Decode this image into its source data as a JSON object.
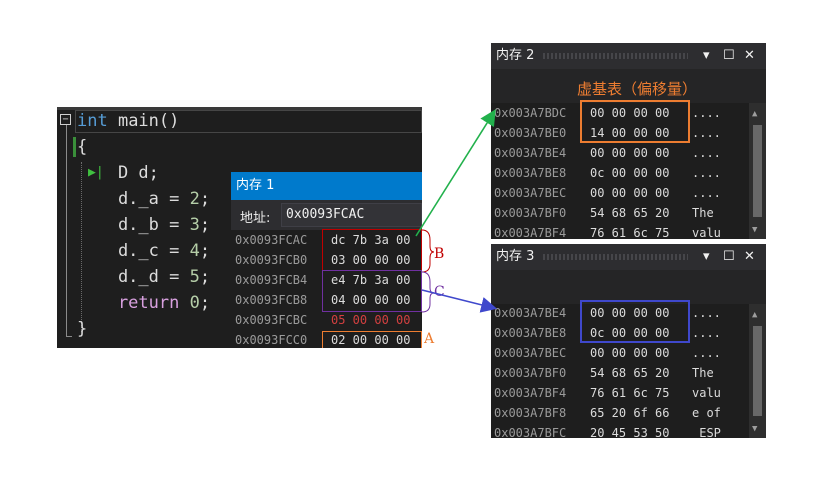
{
  "editor": {
    "fold_marker": "−",
    "lines": [
      {
        "kw": "int",
        "rest": " main()"
      },
      {
        "text": "{"
      },
      {
        "text": "    D d;"
      },
      {
        "text": "    d._a = ",
        "num": "2",
        "tail": ";"
      },
      {
        "text": "    d._b = ",
        "num": "3",
        "tail": ";"
      },
      {
        "text": "    d._c = ",
        "num": "4",
        "tail": ";"
      },
      {
        "text": "    d._d = ",
        "num": "5",
        "tail": ";"
      },
      {
        "ret": "    return",
        "text2": " ",
        "num": "0",
        "tail": ";"
      },
      {
        "text": "}"
      }
    ],
    "exec_arrow": "▶|"
  },
  "mem1": {
    "title": "内存 1",
    "address_label": "地址:",
    "address_value": "0x0093FCAC",
    "rows": [
      {
        "addr": "0x0093FCAC",
        "bytes": "dc 7b 3a 00"
      },
      {
        "addr": "0x0093FCB0",
        "bytes": "03 00 00 00"
      },
      {
        "addr": "0x0093FCB4",
        "bytes": "e4 7b 3a 00"
      },
      {
        "addr": "0x0093FCB8",
        "bytes": "04 00 00 00"
      },
      {
        "addr": "0x0093FCBC",
        "bytes": "05 00 00 00",
        "red": true
      },
      {
        "addr": "0x0093FCC0",
        "bytes": "02 00 00 00"
      }
    ]
  },
  "mem2": {
    "title": "内存 2",
    "caption": "虚基表（偏移量）",
    "rows": [
      {
        "addr": "0x003A7BDC",
        "bytes": "00 00 00 00",
        "chars": "...."
      },
      {
        "addr": "0x003A7BE0",
        "bytes": "14 00 00 00",
        "chars": "...."
      },
      {
        "addr": "0x003A7BE4",
        "bytes": "00 00 00 00",
        "chars": "...."
      },
      {
        "addr": "0x003A7BE8",
        "bytes": "0c 00 00 00",
        "chars": "...."
      },
      {
        "addr": "0x003A7BEC",
        "bytes": "00 00 00 00",
        "chars": "...."
      },
      {
        "addr": "0x003A7BF0",
        "bytes": "54 68 65 20",
        "chars": "The "
      },
      {
        "addr": "0x003A7BF4",
        "bytes": "76 61 6c 75",
        "chars": "valu"
      }
    ]
  },
  "mem3": {
    "title": "内存 3",
    "rows": [
      {
        "addr": "0x003A7BE4",
        "bytes": "00 00 00 00",
        "chars": "...."
      },
      {
        "addr": "0x003A7BE8",
        "bytes": "0c 00 00 00",
        "chars": "...."
      },
      {
        "addr": "0x003A7BEC",
        "bytes": "00 00 00 00",
        "chars": "...."
      },
      {
        "addr": "0x003A7BF0",
        "bytes": "54 68 65 20",
        "chars": "The "
      },
      {
        "addr": "0x003A7BF4",
        "bytes": "76 61 6c 75",
        "chars": "valu"
      },
      {
        "addr": "0x003A7BF8",
        "bytes": "65 20 6f 66",
        "chars": "e of"
      },
      {
        "addr": "0x003A7BFC",
        "bytes": "20 45 53 50",
        "chars": " ESP"
      }
    ]
  },
  "window_controls": {
    "dropdown": "▾",
    "maximize": "☐",
    "close": "✕"
  },
  "annotations": {
    "b": "B",
    "c": "C",
    "a": "A"
  },
  "colors": {
    "box_b": "#c00000",
    "box_c": "#7030a0",
    "box_a": "#ed7d31",
    "arrow_green": "#22b14c",
    "arrow_blue": "#3f48cc",
    "box_mem2": "#ed7d31",
    "box_mem3": "#3f48cc",
    "caption": "#ed7d31"
  }
}
